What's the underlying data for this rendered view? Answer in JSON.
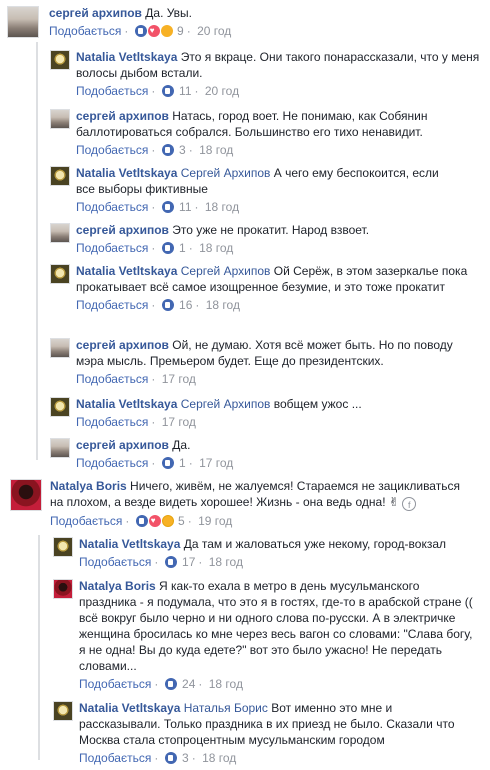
{
  "comments": [
    {
      "author": "сергей архипов",
      "text": "Да. Увы.",
      "like": "Подобається",
      "count": "9",
      "time": "20 год"
    },
    {
      "author": "Natalia Vetltskaya",
      "text": "Это я вкраце. Они такого понарассказали, что у меня волосы дыбом встали.",
      "like": "Подобається",
      "count": "11",
      "time": "20 год"
    },
    {
      "author": "сергей архипов",
      "text": "Натась, город воет. Не понимаю, как Собянин баллотироваться собрался. Большинство его тихо ненавидит.",
      "like": "Подобається",
      "count": "3",
      "time": "18 год"
    },
    {
      "author": "Natalia Vetltskaya",
      "mention": "Сергей Архипов",
      "text": "А чего ему беспокоится, если все выборы фиктивные",
      "like": "Подобається",
      "count": "11",
      "time": "18 год"
    },
    {
      "author": "сергей архипов",
      "text": "Это уже не прокатит. Народ взвоет.",
      "like": "Подобається",
      "count": "1",
      "time": "18 год"
    },
    {
      "author": "Natalia Vetltskaya",
      "mention": "Сергей Архипов",
      "text": "Ой Серёж, в этом зазеркалье пока прокатывает всё самое изощренное безумие, и это тоже прокатит",
      "like": "Подобається",
      "count": "16",
      "time": "18 год"
    },
    {
      "author": "сергей архипов",
      "text": "Ой, не думаю. Хотя всё может быть. Но по поводу мэра мысль. Премьером будет. Еще до президентских.",
      "like": "Подобається",
      "count": "",
      "time": "17 год"
    },
    {
      "author": "Natalia Vetltskaya",
      "mention": "Сергей Архипов",
      "text": "вобщем ужос ...",
      "like": "Подобається",
      "count": "",
      "time": "17 год"
    },
    {
      "author": "сергей архипов",
      "text": "Да.",
      "like": "Подобається",
      "count": "1",
      "time": "17 год"
    },
    {
      "author": "Natalya Boris",
      "text": "Ничего, живём, не жалуемся! Стараемся не зацикливаться на плохом, а везде видеть хорошее! Жизнь - она ведь одна!",
      "like": "Подобається",
      "count": "5",
      "time": "19 год"
    },
    {
      "author": "Natalia Vetltskaya",
      "text": "Да там и жаловаться уже некому, город-вокзал",
      "like": "Подобається",
      "count": "17",
      "time": "18 год"
    },
    {
      "author": "Natalya Boris",
      "text": "Я как-то ехала в метро в день мусульманского праздника - я подумала, что это я в гостях, где-то в арабской стране (( всё вокруг было черно и ни одного слова по-русски. А в электричке женщина бросилась ко мне через весь вагон со словами: \"Слава богу, я не одна! Вы до куда едете?\" вот это было ужасно! Не передать словами...",
      "like": "Подобається",
      "count": "24",
      "time": "18 год"
    },
    {
      "author": "Natalia Vetltskaya",
      "mention": "Наталья Борис",
      "text": "Вот именно это мне и рассказывали. Только праздника в их приезд не было. Сказали что Москва стала стопроцентным мусульманским городом",
      "like": "Подобається",
      "count": "3",
      "time": "18 год"
    }
  ],
  "icons": {
    "like": "like-icon",
    "heart": "heart-react-icon",
    "sad": "sad-react-icon",
    "wow": "wow-react-icon",
    "facebook": "facebook-icon",
    "victory": "victory-hand-emoji"
  },
  "colors": {
    "link": "#365899",
    "meta": "#90949c",
    "like_blue": "#4267b2"
  }
}
